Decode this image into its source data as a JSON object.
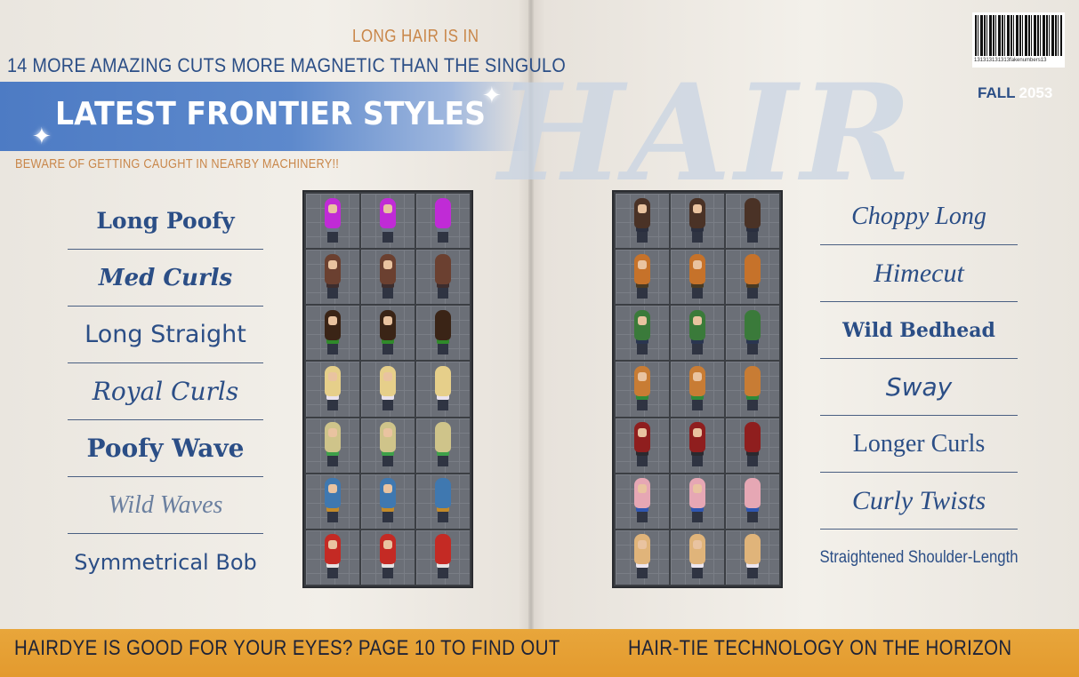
{
  "kicker": "LONG HAIR IS IN",
  "headline": "14 MORE AMAZING CUTS MORE MAGNETIC THAN THE SINGULO",
  "banner_title": "LATEST FRONTIER STYLES",
  "warning": "BEWARE OF GETTING CAUGHT IN NEARBY MACHINERY!!",
  "watermark": "HAIR",
  "barcode_number": "131313131313fakenumbers13",
  "season": "FALL",
  "year": "2053",
  "left_styles": [
    "Long Poofy",
    "Med Curls",
    "Long Straight",
    "Royal Curls",
    "Poofy Wave",
    "Wild Waves",
    "Symmetrical Bob"
  ],
  "right_styles": [
    "Choppy Long",
    "Himecut",
    "Wild Bedhead",
    "Sway",
    "Longer Curls",
    "Curly Twists",
    "Straightened Shoulder-Length"
  ],
  "left_hair_colors": [
    "#c02bd6",
    "#6b4030",
    "#3a2416",
    "#e6cf8a",
    "#cfc48a",
    "#3f78b0",
    "#c42a24"
  ],
  "left_body_colors": [
    "#6b7484",
    "#3d2d2d",
    "#2f8a2a",
    "#e9e2ee",
    "#3ea04a",
    "#c28a2a",
    "#e6e2e2"
  ],
  "right_hair_colors": [
    "#4a3226",
    "#c6722a",
    "#3a7a3a",
    "#c87c34",
    "#8f1e1e",
    "#e6a7b4",
    "#e0b47a"
  ],
  "right_body_colors": [
    "#2a2f3f",
    "#4a3a22",
    "#2a3550",
    "#2f8a3a",
    "#2a2a30",
    "#2f56b0",
    "#ece6f0"
  ],
  "footer_left": "HAIRDYE IS GOOD FOR YOUR EYES? PAGE 10 TO FIND OUT",
  "footer_right": "HAIR-TIE TECHNOLOGY ON THE HORIZON"
}
